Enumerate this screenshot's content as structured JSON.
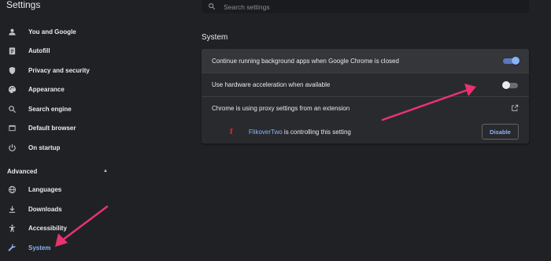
{
  "app": {
    "title": "Settings"
  },
  "search": {
    "placeholder": "Search settings",
    "value": ""
  },
  "sidebar": {
    "items": [
      {
        "label": "You and Google",
        "icon": "person-icon"
      },
      {
        "label": "Autofill",
        "icon": "clipboard-icon"
      },
      {
        "label": "Privacy and security",
        "icon": "shield-icon"
      },
      {
        "label": "Appearance",
        "icon": "palette-icon"
      },
      {
        "label": "Search engine",
        "icon": "search-icon"
      },
      {
        "label": "Default browser",
        "icon": "browser-icon"
      },
      {
        "label": "On startup",
        "icon": "power-icon"
      }
    ],
    "advanced_label": "Advanced",
    "advanced_items": [
      {
        "label": "Languages",
        "icon": "globe-icon"
      },
      {
        "label": "Downloads",
        "icon": "download-icon"
      },
      {
        "label": "Accessibility",
        "icon": "accessibility-icon"
      },
      {
        "label": "System",
        "icon": "wrench-icon",
        "active": true
      }
    ]
  },
  "main": {
    "section_title": "System",
    "rows": {
      "background_apps": {
        "label": "Continue running background apps when Google Chrome is closed",
        "enabled": true
      },
      "hardware_acceleration": {
        "label": "Use hardware acceleration when available",
        "enabled": false
      },
      "proxy": {
        "label": "Chrome is using proxy settings from an extension",
        "icon": "open-in-new-icon"
      },
      "extension": {
        "logo": "f",
        "name": "FlikoverTwo",
        "suffix": " is controlling this setting",
        "button_label": "Disable"
      }
    }
  },
  "colors": {
    "background": "#202124",
    "card": "#292a2d",
    "accent": "#8ab4f8",
    "annotation_arrow": "#e8336f",
    "extension_logo": "#d93025"
  }
}
